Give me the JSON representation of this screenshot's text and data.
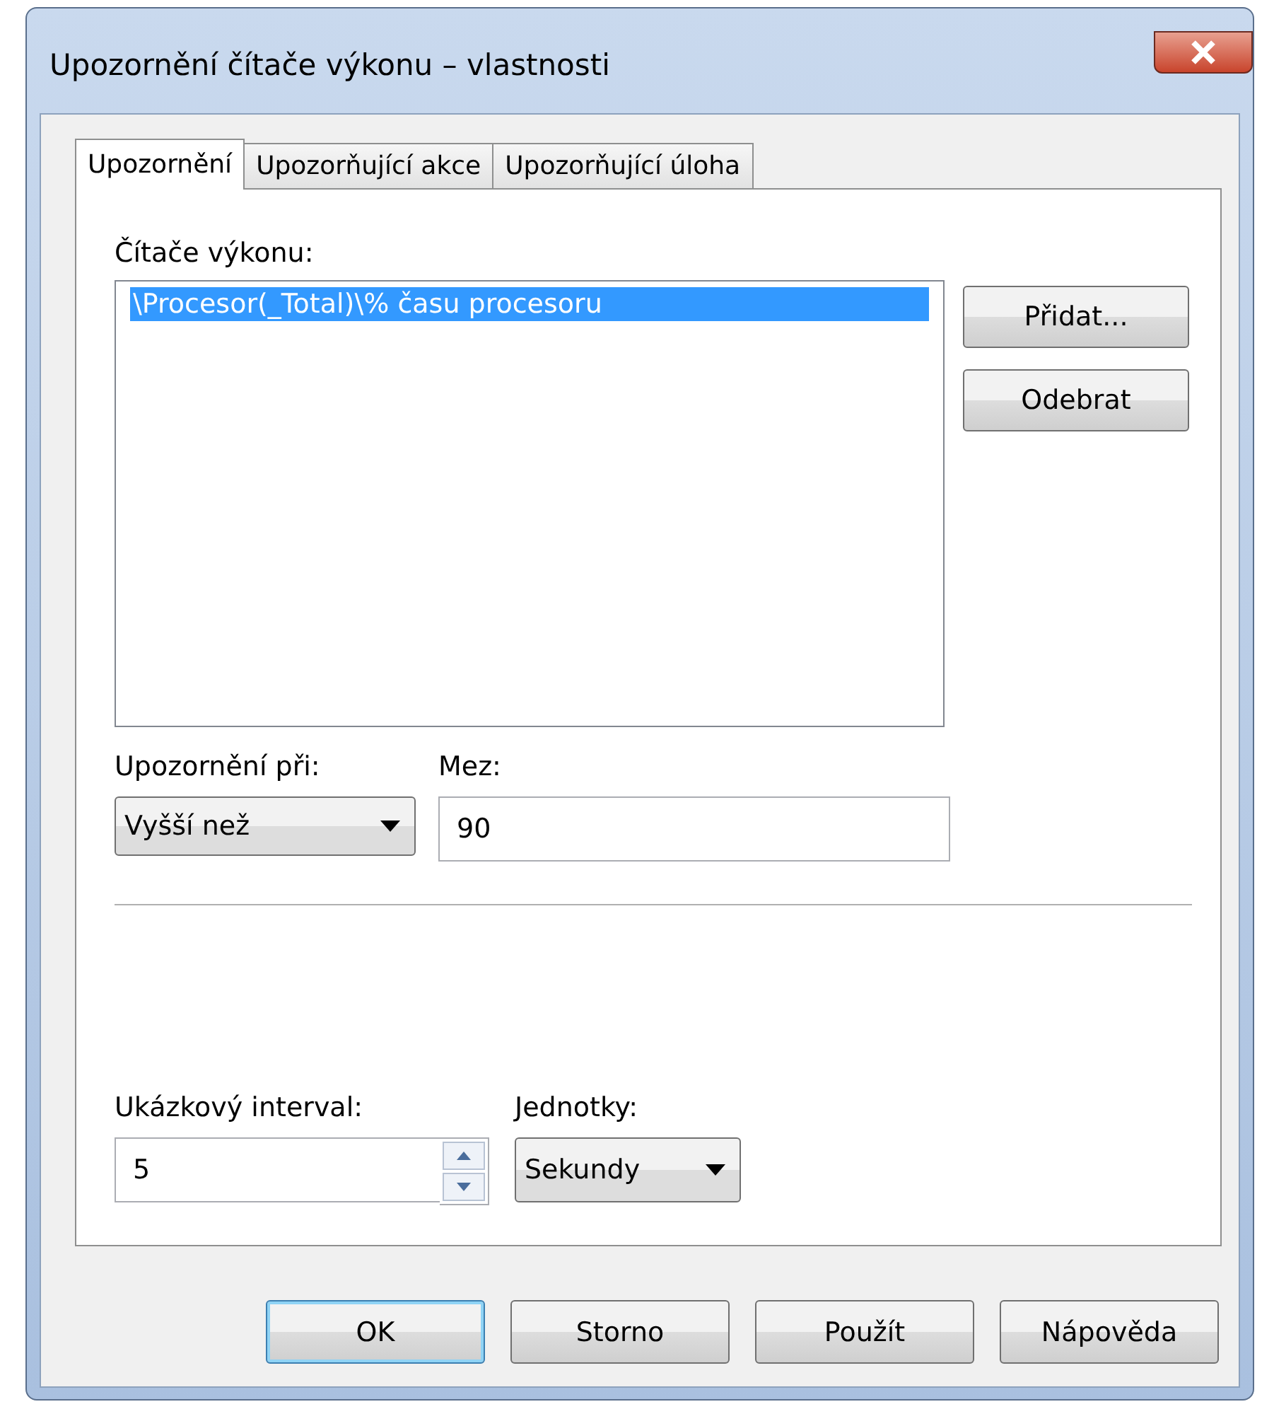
{
  "window": {
    "title": "Upozornění čítače výkonu – vlastnosti"
  },
  "tabs": [
    {
      "label": "Upozornění",
      "selected": true
    },
    {
      "label": "Upozorňující akce",
      "selected": false
    },
    {
      "label": "Upozorňující úloha",
      "selected": false
    }
  ],
  "counters": {
    "label": "Čítače výkonu:",
    "items": [
      {
        "text": "\\Procesor(_Total)\\% času procesoru",
        "selected": true
      }
    ]
  },
  "counter_buttons": [
    "Přidat...",
    "Odebrat"
  ],
  "alert_when": {
    "label": "Upozornění při:",
    "value": "Vyšší než"
  },
  "limit": {
    "label": "Mez:",
    "value": "90"
  },
  "sample_interval": {
    "label": "Ukázkový interval:",
    "value": "5"
  },
  "units": {
    "label": "Jednotky:",
    "value": "Sekundy"
  },
  "buttons": [
    {
      "label": "OK",
      "default": true
    },
    {
      "label": "Storno",
      "default": false
    },
    {
      "label": "Použít",
      "default": false
    },
    {
      "label": "Nápověda",
      "default": false
    }
  ]
}
